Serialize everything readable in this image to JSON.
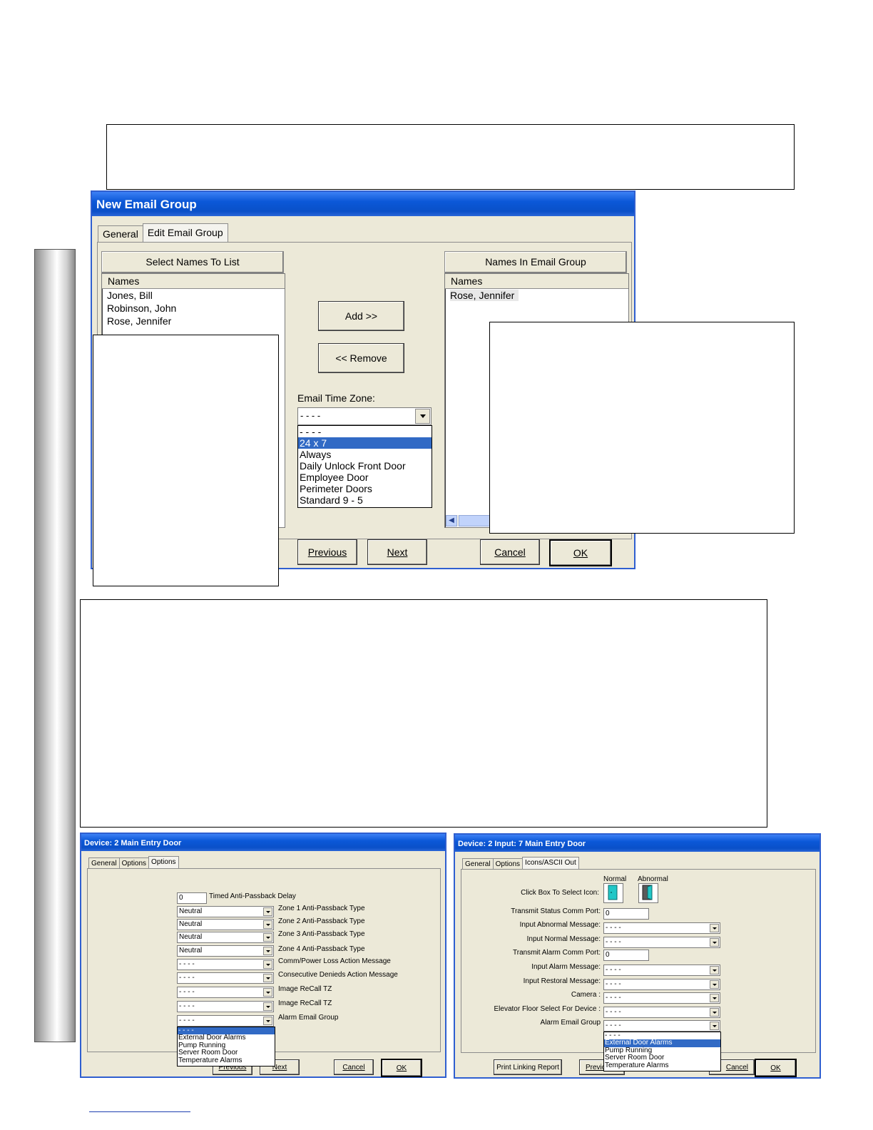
{
  "top_callout": {
    "text": ""
  },
  "email_group_dialog": {
    "title": "New Email Group",
    "tabs": [
      "General",
      "Edit Email Group"
    ],
    "left_header": "Select Names To List",
    "right_header": "Names In Email Group",
    "left_column": "Names",
    "right_column": "Names",
    "available_names": [
      "Jones, Bill",
      "Robinson, John",
      "Rose, Jennifer"
    ],
    "group_names": [
      "Rose, Jennifer"
    ],
    "add_button": "Add >>",
    "remove_button": "<< Remove",
    "time_zone_label": "Email Time Zone:",
    "time_zone_value": "- - - -",
    "time_zone_options": [
      "- - - -",
      "24 x 7",
      "Always",
      "Daily Unlock Front Door",
      "Employee Door",
      "Perimeter Doors",
      "Standard 9 - 5"
    ],
    "time_zone_selected": "24 x 7",
    "buttons": {
      "previous": "Previous",
      "next": "Next",
      "cancel": "Cancel",
      "ok": "OK"
    }
  },
  "device_dialog": {
    "title": "Device:  2  Main Entry Door",
    "tabs": [
      "General",
      "Options",
      "Options"
    ],
    "delay_value": "0",
    "delay_label": "Timed Anti-Passback Delay",
    "rows": [
      {
        "value": "Neutral",
        "label": "Zone 1 Anti-Passback Type"
      },
      {
        "value": "Neutral",
        "label": "Zone 2 Anti-Passback Type"
      },
      {
        "value": "Neutral",
        "label": "Zone 3 Anti-Passback Type"
      },
      {
        "value": "Neutral",
        "label": "Zone 4 Anti-Passback Type"
      },
      {
        "value": "- - - -",
        "label": "Comm/Power Loss Action Message"
      },
      {
        "value": "- - - -",
        "label": "Consecutive Denieds Action Message"
      },
      {
        "value": "- - - -",
        "label": "Image ReCall TZ"
      },
      {
        "value": "- - - -",
        "label": "Image ReCall TZ"
      },
      {
        "value": "- - - -",
        "label": "Alarm Email Group"
      }
    ],
    "alarm_options": [
      "- - - -",
      "External Door Alarms",
      "Pump Running",
      "Server Room Door",
      "Temperature Alarms"
    ],
    "alarm_selected": "- - - -",
    "buttons": {
      "previous": "Previous",
      "next": "Next",
      "cancel": "Cancel",
      "ok": "OK"
    }
  },
  "input_dialog": {
    "title": "Device:  2  Input:  7  Main Entry Door",
    "tabs": [
      "General",
      "Options",
      "Icons/ASCII Out"
    ],
    "normal_label": "Normal",
    "abnormal_label": "Abnormal",
    "icon_label": "Click Box To Select Icon:",
    "rows": [
      {
        "label": "Transmit Status Comm Port:",
        "value": "0",
        "kind": "text"
      },
      {
        "label": "Input Abnormal Message:",
        "value": "- - - -",
        "kind": "combo"
      },
      {
        "label": "Input Normal Message:",
        "value": "- - - -",
        "kind": "combo"
      },
      {
        "label": "Transmit Alarm Comm Port:",
        "value": "0",
        "kind": "text"
      },
      {
        "label": "Input Alarm Message:",
        "value": "- - - -",
        "kind": "combo"
      },
      {
        "label": "Input Restoral Message:",
        "value": "- - - -",
        "kind": "combo"
      },
      {
        "label": "Camera :",
        "value": "- - - -",
        "kind": "combo"
      },
      {
        "label": "Elevator Floor Select For Device :",
        "value": "- - - -",
        "kind": "combo"
      },
      {
        "label": "Alarm Email Group",
        "value": "- - - -",
        "kind": "combo"
      }
    ],
    "alarm_options": [
      "- - - -",
      "External Door Alarms",
      "Pump Running",
      "Server Room Door",
      "Temperature Alarms"
    ],
    "alarm_selected": "External Door Alarms",
    "buttons": {
      "print": "Print Linking Report",
      "previous": "Previous",
      "cancel": "Cancel",
      "ok": "OK"
    }
  }
}
